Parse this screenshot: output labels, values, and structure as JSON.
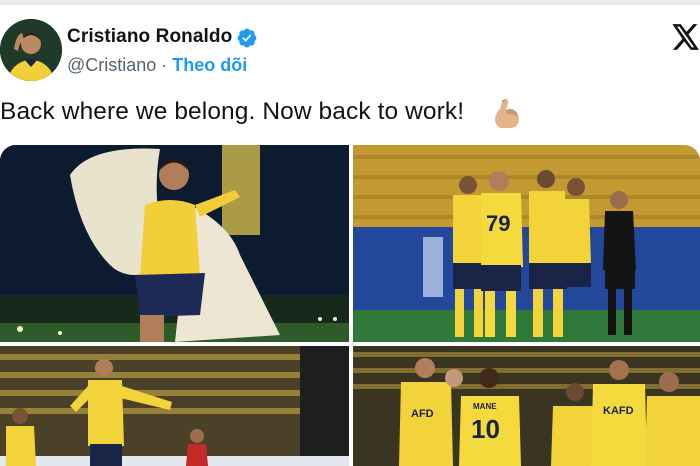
{
  "author": {
    "name": "Cristiano Ronaldo",
    "handle": "@Cristiano",
    "separator": "·",
    "follow_label": "Theo dõi"
  },
  "tweet": {
    "text": "Back where we belong. Now back to work!",
    "emoji": "flexed-biceps"
  },
  "icons": [
    "verified-badge-icon",
    "x-logo-icon",
    "flexed-biceps-emoji"
  ],
  "colors": {
    "link": "#1d9bf0",
    "verified": "#1d9bf0",
    "text": "#0f1419",
    "muted": "#536471",
    "kit_yellow": "#f2d13a",
    "kit_navy": "#1a2446"
  },
  "media": {
    "photo_count": 4,
    "photos": [
      {
        "jersey_number": ""
      },
      {
        "jersey_number": "79"
      },
      {
        "jersey_number": ""
      },
      {
        "jersey_number": "10",
        "sponsor": "AFD",
        "sponsor_2": "KAFD",
        "shirt_name": "MANE"
      }
    ]
  }
}
